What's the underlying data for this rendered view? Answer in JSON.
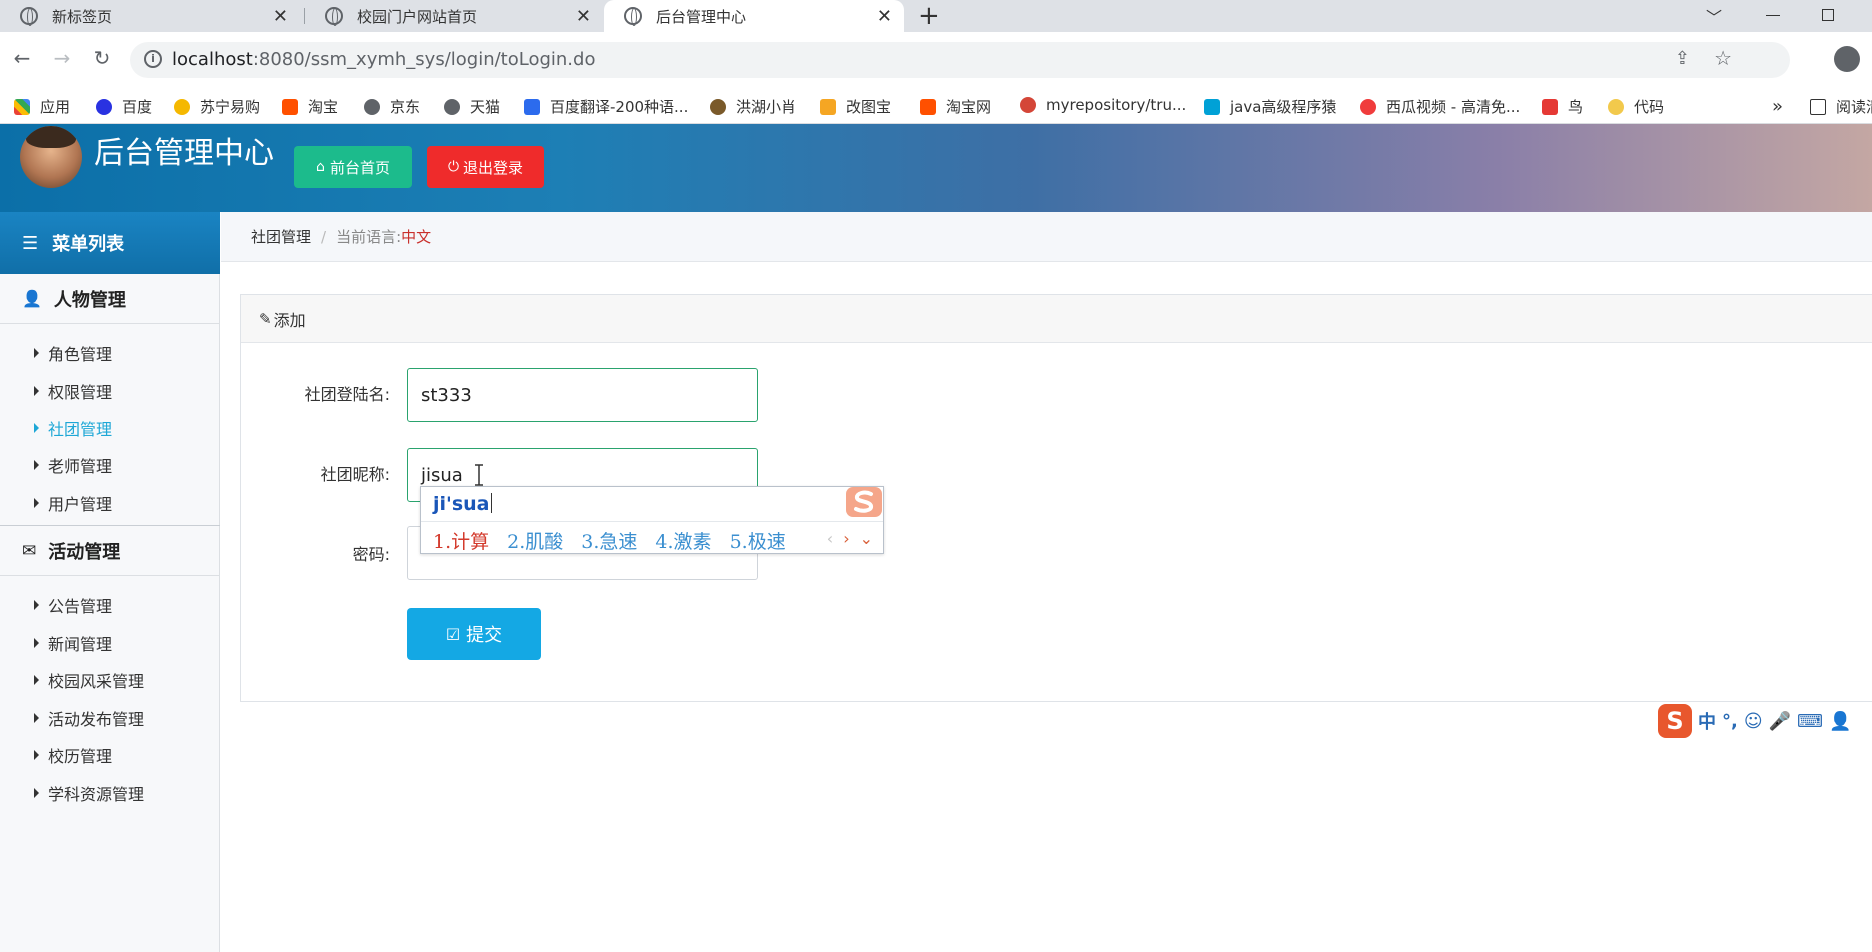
{
  "browser": {
    "tabs": [
      {
        "title": "新标签页",
        "active": false
      },
      {
        "title": "校园门户网站首页",
        "active": false
      },
      {
        "title": "后台管理中心",
        "active": true
      }
    ],
    "new_tab": "+",
    "url_host": "localhost",
    "url_rest": ":8080/ssm_xymh_sys/login/toLogin.do",
    "bookmarks": [
      {
        "label": "应用",
        "color": "#4285f4"
      },
      {
        "label": "百度",
        "color": "#2932e1"
      },
      {
        "label": "苏宁易购",
        "color": "#f5b800"
      },
      {
        "label": "淘宝",
        "color": "#ff5000"
      },
      {
        "label": "京东",
        "color": "#5f6368"
      },
      {
        "label": "天猫",
        "color": "#5f6368"
      },
      {
        "label": "百度翻译-200种语...",
        "color": "#2c6bed"
      },
      {
        "label": "洪湖小肖",
        "color": "#7a5a2a"
      },
      {
        "label": "改图宝",
        "color": "#f5a623"
      },
      {
        "label": "淘宝网",
        "color": "#ff5000"
      },
      {
        "label": "myrepository/tru...",
        "color": "#d44638"
      },
      {
        "label": "java高级程序猿",
        "color": "#00a1d6"
      },
      {
        "label": "西瓜视频 - 高清免...",
        "color": "#f03c3c"
      },
      {
        "label": "鸟",
        "color": "#e53935"
      },
      {
        "label": "代码",
        "color": "#f2c94c"
      }
    ],
    "bookmarks_more": "»",
    "reading_list": "阅读清"
  },
  "header": {
    "title": "后台管理中心",
    "home_button": "前台首页",
    "logout_button": "退出登录",
    "home_color": "#1cbb8c",
    "logout_color": "#ef2b2b"
  },
  "sidebar": {
    "menu_title": "菜单列表",
    "groups": [
      {
        "title": "人物管理",
        "items": [
          "角色管理",
          "权限管理",
          "社团管理",
          "老师管理",
          "用户管理"
        ]
      },
      {
        "title": "活动管理",
        "items": [
          "公告管理",
          "新闻管理",
          "校园风采管理",
          "活动发布管理",
          "校历管理",
          "学科资源管理"
        ]
      }
    ],
    "active_item": "社团管理",
    "accent": "#1ea7d6"
  },
  "breadcrumb": {
    "section": "社团管理",
    "separator": "/",
    "lang_label": "当前语言:",
    "lang_value": "中文"
  },
  "form": {
    "panel_title": "添加",
    "login_label": "社团登陆名:",
    "login_value": "st333",
    "nickname_label": "社团昵称:",
    "nickname_value": "jisua",
    "password_label": "密码:",
    "password_value": "",
    "submit": "提交"
  },
  "ime": {
    "composition": "ji'sua",
    "candidates": [
      "1.计算",
      "2.肌酸",
      "3.急速",
      "4.激素",
      "5.极速"
    ],
    "status_mode": "中",
    "status_punct": "°,"
  }
}
